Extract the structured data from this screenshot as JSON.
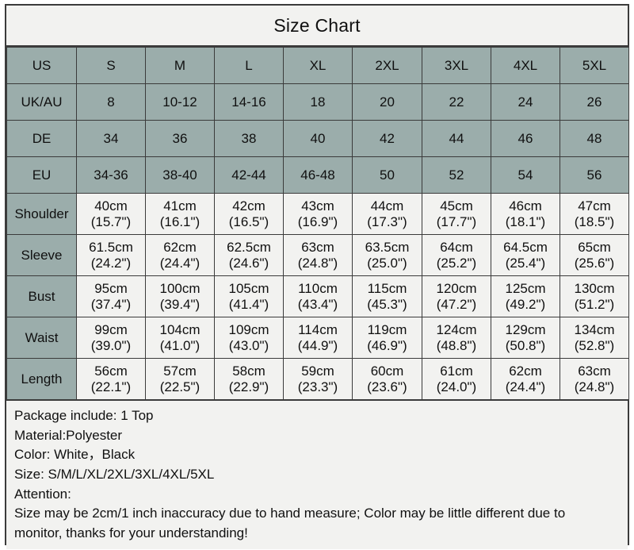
{
  "title": "Size Chart",
  "colors": {
    "sage": "#9badab",
    "cell": "#f2f2f0",
    "gridline": "#3b3b3b",
    "text": "#101010"
  },
  "table": {
    "size_rows": [
      {
        "label": "US",
        "values": [
          "S",
          "M",
          "L",
          "XL",
          "2XL",
          "3XL",
          "4XL",
          "5XL"
        ]
      },
      {
        "label": "UK/AU",
        "values": [
          "8",
          "10-12",
          "14-16",
          "18",
          "20",
          "22",
          "24",
          "26"
        ]
      },
      {
        "label": "DE",
        "values": [
          "34",
          "36",
          "38",
          "40",
          "42",
          "44",
          "46",
          "48"
        ]
      },
      {
        "label": "EU",
        "values": [
          "34-36",
          "38-40",
          "42-44",
          "46-48",
          "50",
          "52",
          "54",
          "56"
        ]
      }
    ],
    "measurement_rows": [
      {
        "label": "Shoulder",
        "cm": [
          "40cm",
          "41cm",
          "42cm",
          "43cm",
          "44cm",
          "45cm",
          "46cm",
          "47cm"
        ],
        "inch": [
          "(15.7\")",
          "(16.1\")",
          "(16.5\")",
          "(16.9\")",
          "(17.3\")",
          "(17.7\")",
          "(18.1\")",
          "(18.5\")"
        ]
      },
      {
        "label": "Sleeve",
        "cm": [
          "61.5cm",
          "62cm",
          "62.5cm",
          "63cm",
          "63.5cm",
          "64cm",
          "64.5cm",
          "65cm"
        ],
        "inch": [
          "(24.2\")",
          "(24.4\")",
          "(24.6\")",
          "(24.8\")",
          "(25.0\")",
          "(25.2\")",
          "(25.4\")",
          "(25.6\")"
        ]
      },
      {
        "label": "Bust",
        "cm": [
          "95cm",
          "100cm",
          "105cm",
          "110cm",
          "115cm",
          "120cm",
          "125cm",
          "130cm"
        ],
        "inch": [
          "(37.4\")",
          "(39.4\")",
          "(41.4\")",
          "(43.4\")",
          "(45.3\")",
          "(47.2\")",
          "(49.2\")",
          "(51.2\")"
        ]
      },
      {
        "label": "Waist",
        "cm": [
          "99cm",
          "104cm",
          "109cm",
          "114cm",
          "119cm",
          "124cm",
          "129cm",
          "134cm"
        ],
        "inch": [
          "(39.0\")",
          "(41.0\")",
          "(43.0\")",
          "(44.9\")",
          "(46.9\")",
          "(48.8\")",
          "(50.8\")",
          "(52.8\")"
        ]
      },
      {
        "label": "Length",
        "cm": [
          "56cm",
          "57cm",
          "58cm",
          "59cm",
          "60cm",
          "61cm",
          "62cm",
          "63cm"
        ],
        "inch": [
          "(22.1\")",
          "(22.5\")",
          "(22.9\")",
          "(23.3\")",
          "(23.6\")",
          "(24.0\")",
          "(24.4\")",
          "(24.8\")"
        ]
      }
    ]
  },
  "notes": [
    "Package include: 1 Top",
    "Material:Polyester",
    "Color: White，Black",
    "Size: S/M/L/XL/2XL/3XL/4XL/5XL",
    "Attention:",
    "Size may be 2cm/1 inch inaccuracy due to hand measure; Color may be little different due to",
    "monitor, thanks for your understanding!"
  ]
}
